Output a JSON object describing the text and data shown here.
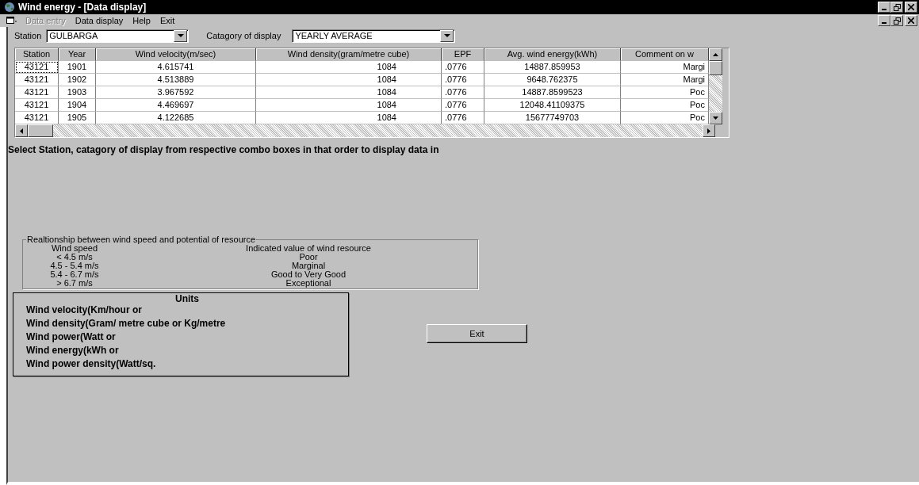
{
  "window": {
    "title": "Wind energy - [Data display]"
  },
  "menu": [
    {
      "label": "Data entry",
      "disabled": true
    },
    {
      "label": "Data display",
      "disabled": false
    },
    {
      "label": "Help",
      "disabled": false
    },
    {
      "label": "Exit",
      "disabled": false
    }
  ],
  "station": {
    "label": "Station",
    "value": "GULBARGA"
  },
  "category": {
    "label": "Catagory of display",
    "value": "YEARLY AVERAGE"
  },
  "table": {
    "columns": [
      "Station",
      "Year",
      "Wind velocity(m/sec)",
      "Wind density(gram/metre cube)",
      "EPF",
      "Avg. wind energy(kWh)",
      "Comment on w"
    ],
    "rows": [
      {
        "focused": true,
        "cells": [
          "43121",
          "1901",
          "4.615741",
          "1084",
          ".0776",
          "14887.859953",
          "Margi"
        ]
      },
      {
        "focused": false,
        "cells": [
          "43121",
          "1902",
          "4.513889",
          "1084",
          ".0776",
          "9648.762375",
          "Margi"
        ]
      },
      {
        "focused": false,
        "cells": [
          "43121",
          "1903",
          "3.967592",
          "1084",
          ".0776",
          "14887.8599523",
          "Poc"
        ]
      },
      {
        "focused": false,
        "cells": [
          "43121",
          "1904",
          "4.469697",
          "1084",
          ".0776",
          "12048.41109375",
          "Poc"
        ]
      },
      {
        "focused": false,
        "cells": [
          "43121",
          "1905",
          "4.122685",
          "1084",
          ".0776",
          "15677749703",
          "Poc"
        ]
      }
    ]
  },
  "instruction": "Select Station, catagory of display from respective combo boxes in that order to display data in",
  "relationship": {
    "title": "Realtionship between wind speed and potential of resource",
    "headers": [
      "Wind speed",
      "Indicated value of wind resource"
    ],
    "rows": [
      [
        "< 4.5 m/s",
        "Poor"
      ],
      [
        "4.5 - 5.4 m/s",
        "Marginal"
      ],
      [
        "5.4 - 6.7 m/s",
        "Good to Very Good"
      ],
      [
        "> 6.7 m/s",
        "Exceptional"
      ]
    ]
  },
  "units": {
    "title": "Units",
    "lines": [
      "Wind velocity(Km/hour or",
      "Wind density(Gram/ metre cube or Kg/metre",
      "Wind power(Watt or",
      "Wind energy(kWh or",
      "Wind power density(Watt/sq."
    ]
  },
  "exit_button": "Exit"
}
